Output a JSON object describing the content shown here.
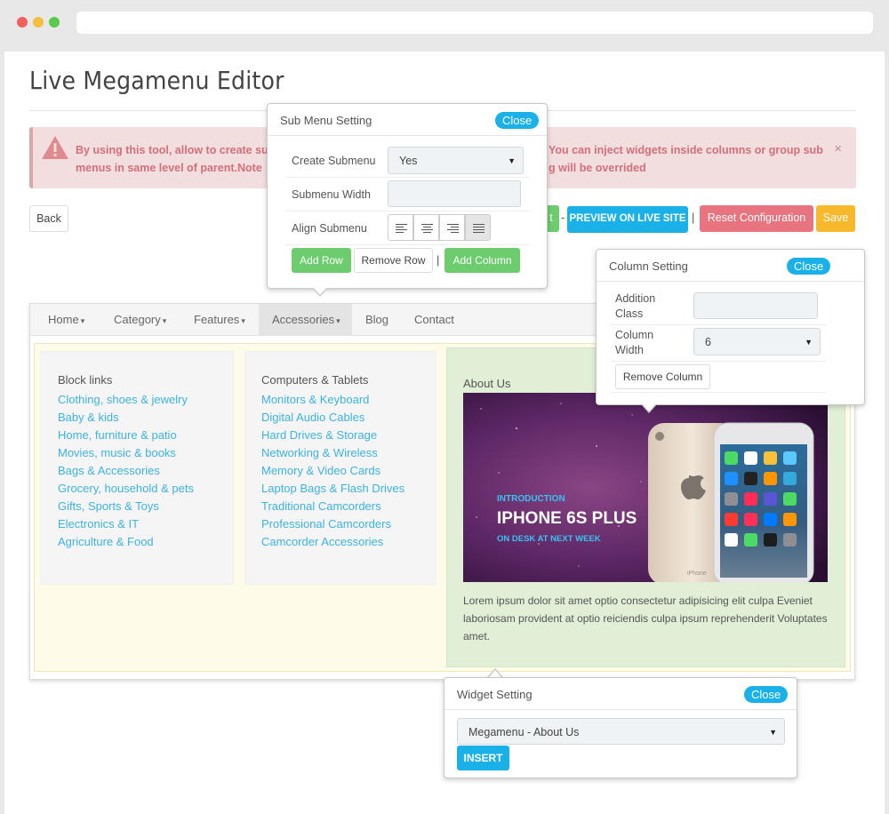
{
  "page_title": "Live Megamenu Editor",
  "alert": {
    "text_line1": "By using this tool, allow to create sub",
    "text_line1_end": "You can inject widgets inside columns or group sub",
    "text_line2": "menus in same level of parent.Note",
    "text_line2_end": "g will be overrided",
    "close_glyph": "×"
  },
  "toolbar": {
    "back_label": "Back",
    "hidden_btn_label": "t",
    "dash": "-",
    "preview_label": "PREVIEW ON LIVE SITE",
    "pipe": "|",
    "reset_label": "Reset Configuration",
    "save_label": "Save"
  },
  "navbar": {
    "items": [
      {
        "label": "Home",
        "caret": "▾"
      },
      {
        "label": "Category",
        "caret": "▾"
      },
      {
        "label": "Features",
        "caret": "▾"
      },
      {
        "label": "Accessories",
        "caret": "▾"
      },
      {
        "label": "Blog"
      },
      {
        "label": "Contact"
      }
    ]
  },
  "columns": {
    "block_links": {
      "title": "Block links",
      "links": [
        "Clothing, shoes & jewelry",
        "Baby & kids",
        "Home, furniture & patio",
        "Movies, music & books",
        "Bags & Accessories",
        "Grocery, household & pets",
        "Gifts, Sports & Toys",
        "Electronics & IT",
        "Agriculture & Food"
      ]
    },
    "computers": {
      "title": "Computers & Tablets",
      "links": [
        "Monitors & Keyboard",
        "Digital Audio Cables",
        "Hard Drives & Storage",
        "Networking & Wireless",
        "Memory & Video Cards",
        "Laptop Bags & Flash Drives",
        "Traditional Camcorders",
        "Professional Camcorders",
        "Camcorder Accessories"
      ]
    },
    "about": {
      "title": "About Us",
      "banner_intro": "INTRODUCTION",
      "banner_title": "IPHONE 6S PLUS",
      "banner_sub": "ON DESK AT NEXT WEEK",
      "phone_brand": "iPhone",
      "text": "Lorem ipsum dolor sit amet optio consectetur adipisicing elit culpa Eveniet laboriosam provident at optio reiciendis culpa ipsum reprehenderit Voluptates amet."
    }
  },
  "submenu_popup": {
    "title": "Sub Menu Setting",
    "close_label": "Close",
    "create_label": "Create Submenu",
    "create_value": "Yes",
    "width_label": "Submenu Width",
    "width_value": "",
    "align_label": "Align Submenu",
    "align_selected": "justify",
    "add_row_label": "Add Row",
    "remove_row_label": "Remove Row",
    "pipe": "|",
    "add_column_label": "Add Column"
  },
  "column_popup": {
    "title": "Column Setting",
    "close_label": "Close",
    "class_label_1": "Addition",
    "class_label_2": "Class",
    "class_value": "",
    "width_label_1": "Column",
    "width_label_2": "Width",
    "width_value": "6",
    "remove_label": "Remove Column"
  },
  "widget_popup": {
    "title": "Widget Setting",
    "close_label": "Close",
    "select_value": "Megamenu - About Us",
    "insert_label": "INSERT"
  },
  "colors": {
    "accent": "#1ab0e8",
    "success": "#6ccc6e",
    "danger": "#e7747e",
    "warning": "#f7b82b",
    "link": "#3bb3e0"
  }
}
